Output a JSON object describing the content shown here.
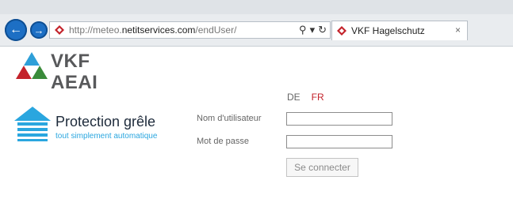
{
  "browser": {
    "url_prefix": "http://meteo.",
    "url_domain": "netitservices.com",
    "url_path": "/endUser/",
    "search_glyph": "⚲",
    "dropdown_glyph": "▾",
    "refresh_glyph": "↻",
    "tab_title": "VKF Hagelschutz",
    "tab_close": "×",
    "back_glyph": "←",
    "forward_glyph": "→",
    "icons": {
      "back": "back-arrow-icon",
      "forward": "forward-arrow-icon",
      "site": "vkf-favicon-icon",
      "search": "search-icon",
      "refresh": "refresh-icon",
      "close": "close-icon"
    }
  },
  "logo": {
    "line1": "VKF",
    "line2": "AEAI"
  },
  "brand": {
    "title": "Protection grêle",
    "subtitle": "tout simplement automatique"
  },
  "language": {
    "de": "DE",
    "fr": "FR",
    "active": "FR"
  },
  "form": {
    "username_label": "Nom d'utilisateur",
    "password_label": "Mot de passe",
    "username_value": "",
    "password_value": "",
    "submit_label": "Se connecter"
  },
  "colors": {
    "accent_red": "#c3222a",
    "brand_blue": "#2aa6df",
    "browser_blue": "#1d6fc4"
  }
}
